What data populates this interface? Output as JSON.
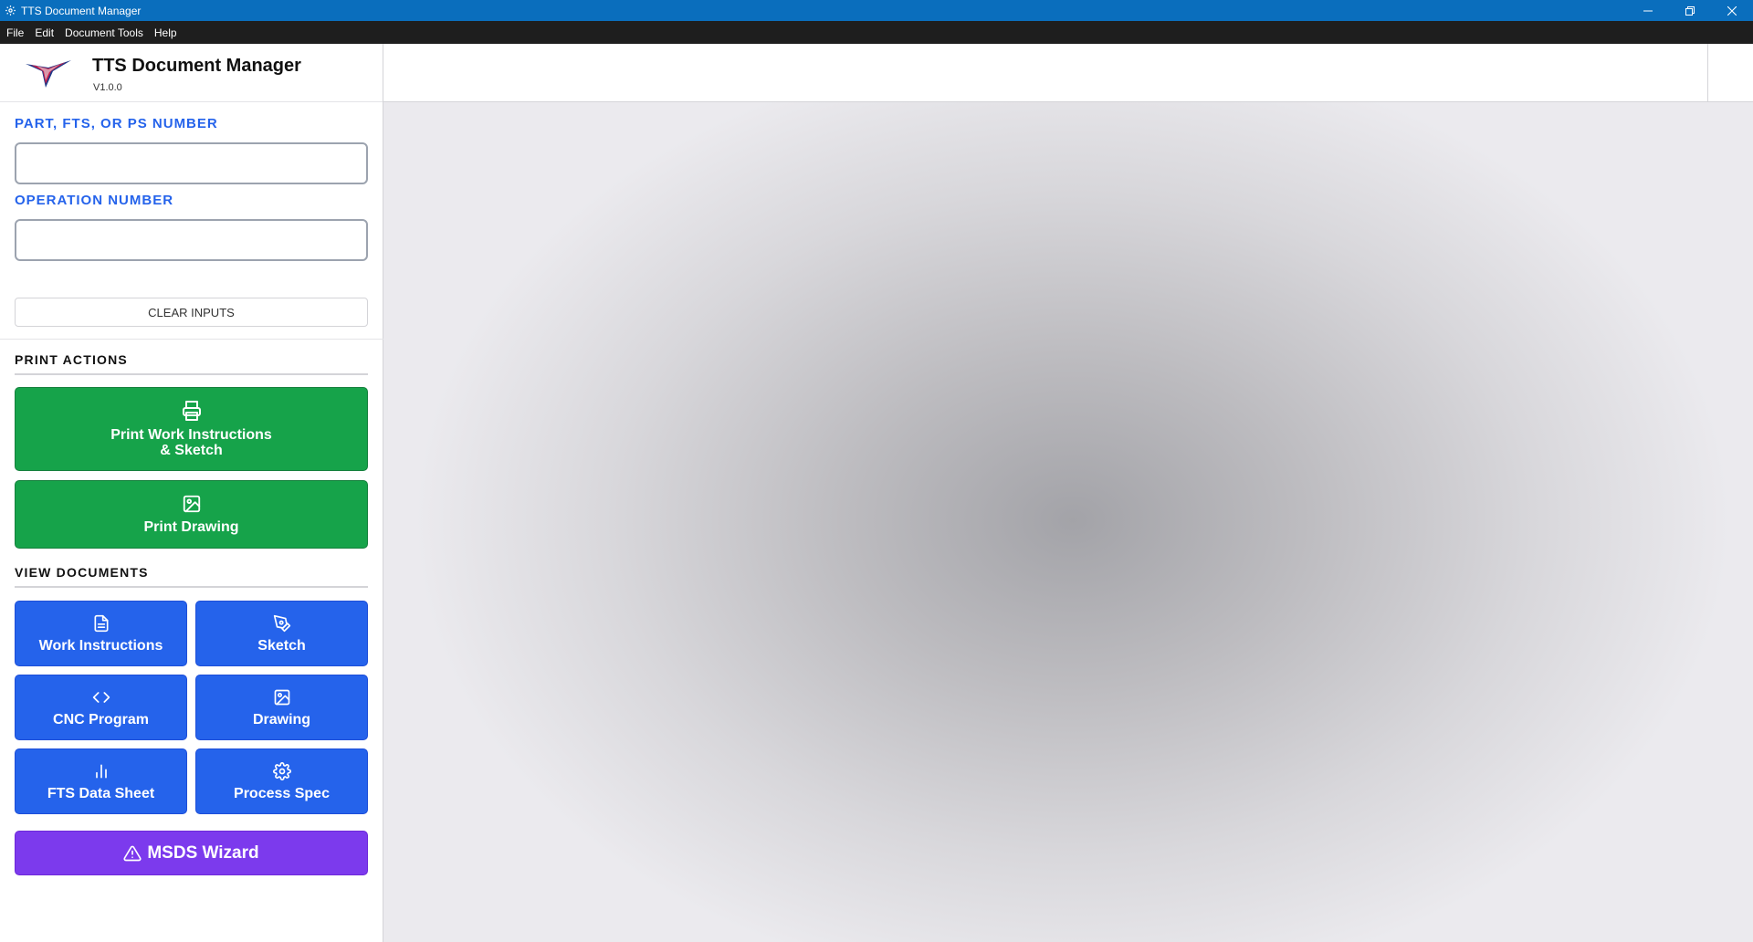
{
  "window": {
    "title": "TTS Document Manager"
  },
  "menu": [
    "File",
    "Edit",
    "Document Tools",
    "Help"
  ],
  "brand": {
    "name": "TTS Document Manager",
    "version": "V1.0.0"
  },
  "inputs": {
    "part_label": "PART, FTS, OR PS NUMBER",
    "part_value": "",
    "operation_label": "OPERATION NUMBER",
    "operation_value": "",
    "clear_label": "CLEAR INPUTS"
  },
  "print_actions": {
    "title": "PRINT ACTIONS",
    "work_instructions_sketch_line1": "Print Work Instructions",
    "work_instructions_sketch_line2": "& Sketch",
    "drawing": "Print Drawing"
  },
  "view_documents": {
    "title": "VIEW DOCUMENTS",
    "work_instructions": "Work Instructions",
    "sketch": "Sketch",
    "cnc_program": "CNC Program",
    "drawing": "Drawing",
    "fts_data_sheet": "FTS Data Sheet",
    "process_spec": "Process Spec"
  },
  "msds": {
    "label": "MSDS Wizard"
  },
  "colors": {
    "titlebar": "#0a6ebd",
    "menubar": "#1e1e1e",
    "label_blue": "#2563eb",
    "print_green": "#16a34a",
    "view_blue": "#2563eb",
    "msds_purple": "#7c3aed"
  },
  "icons": [
    "printer-icon",
    "image-icon",
    "document-icon",
    "pen-icon",
    "code-icon",
    "bar-chart-icon",
    "gear-icon",
    "warning-icon"
  ]
}
